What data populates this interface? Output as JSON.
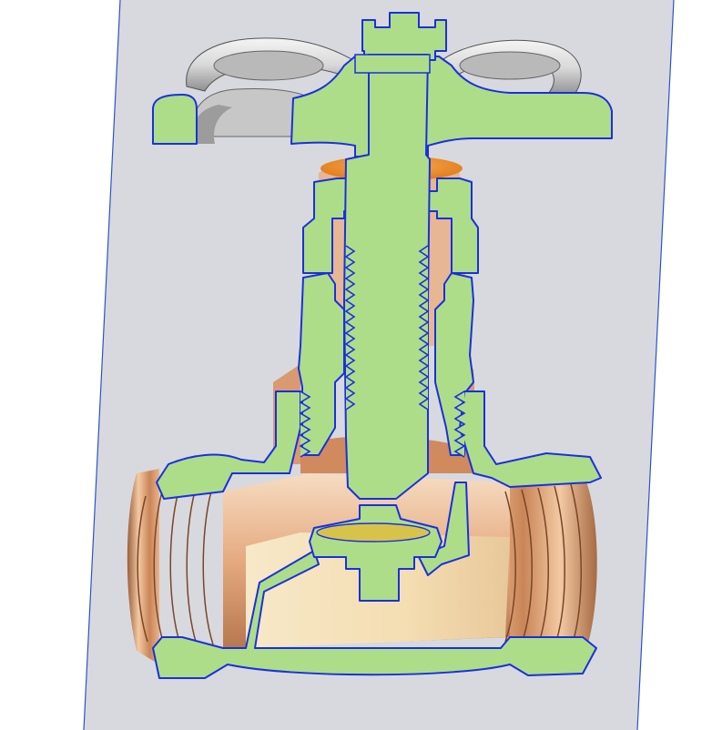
{
  "viewport": {
    "background": "#ffffff",
    "plane_fill": "#d8d9de",
    "plane_edge": "#2b53c9"
  },
  "model": {
    "name_icon": "valve-section-icon",
    "section_fill": "#aedd8a",
    "section_edge": "#1a2fe0",
    "bronze_light": "#f2c9a4",
    "bronze_mid": "#d99a72",
    "bronze_dark": "#9a5e3c",
    "handwheel_fill": "#e6e6e6",
    "handwheel_shadow": "#8f8f8f",
    "gland_orange": "#f2962e",
    "disc_yellow": "#d8c34a"
  }
}
